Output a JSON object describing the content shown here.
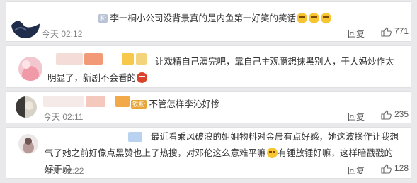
{
  "comments": [
    {
      "tag": "粉",
      "text": "李一桐小公司没背景真的是内鱼第一好笑的笑话",
      "time": "今天 02:12",
      "reply_label": "回复",
      "likes": "771"
    },
    {
      "text": "让戏精自己演完吧，靠自己主观臆想抹黑别人，于大妈炒作太明显了，新剧不会看的"
    },
    {
      "tag": "铁粉",
      "text": "不管怎样李沁好惨",
      "time": "今天 02:11",
      "reply_label": "回复",
      "likes": "235"
    },
    {
      "text_part1": "最近看乘风破浪的姐姐物料对金晨有点好感，她这波操作让我想气了她之前好像点黑赞也上了热搜，对邓伦这么意难平嘛",
      "text_part2": "有锤放锤好嘛，这样暗戳戳的好于妈",
      "time": "今天 02:22",
      "reply_label": "回复",
      "likes": "128"
    }
  ],
  "colors": {
    "accent_blue": "#2b6cc4",
    "muted": "#808080"
  },
  "icons": {
    "like": "thumbs-up-icon",
    "avatar": "avatar-image"
  }
}
